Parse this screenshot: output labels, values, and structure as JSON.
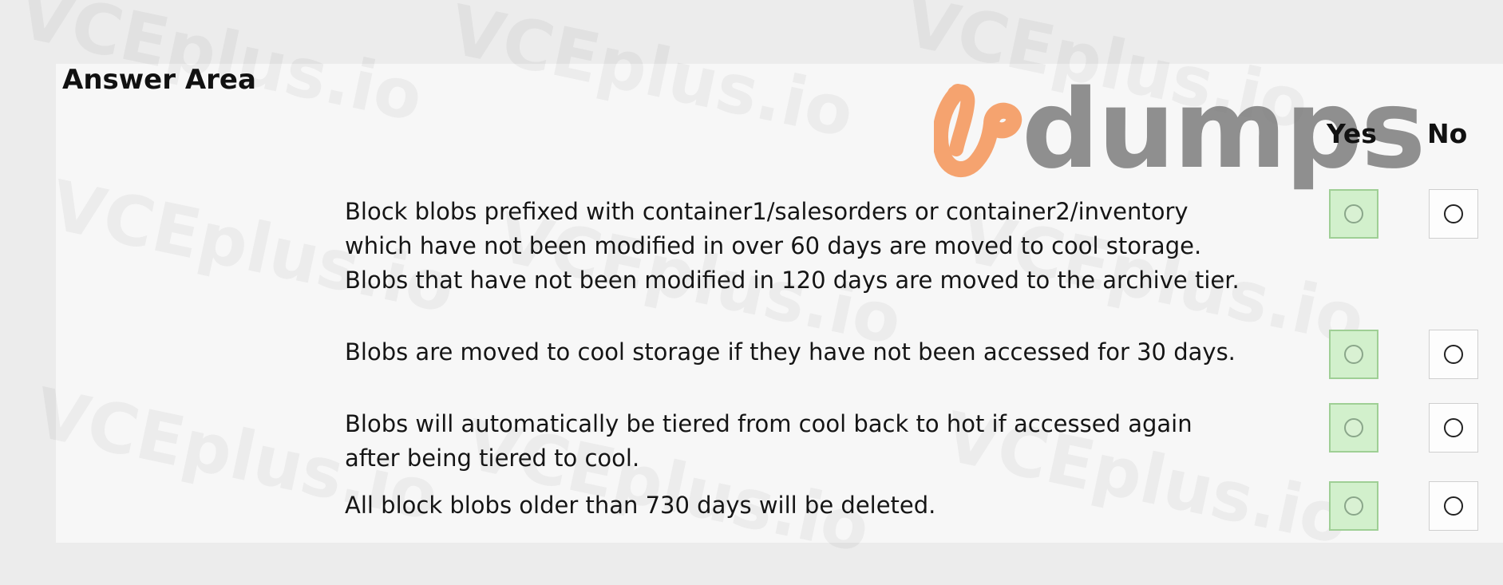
{
  "page": {
    "title": "Answer Area",
    "columns": {
      "yes": "Yes",
      "no": "No"
    },
    "watermark": "VCEplus.io",
    "logo": {
      "text": "dumps",
      "mark_color": "#f5a36f",
      "text_color": "#7d7d7d"
    },
    "colors": {
      "background": "#ececec",
      "panel": "#f7f7f7",
      "yes_fill": "#d2f0cc",
      "yes_border": "#9fcf95"
    }
  },
  "statements": [
    {
      "lines": [
        "Block blobs prefixed with container1/salesorders or container2/inventory",
        "which have not been modified in over 60 days are moved to cool storage.",
        "Blobs that have not been modified in 120 days are moved to the archive tier."
      ],
      "selected": "yes"
    },
    {
      "lines": [
        "Blobs are moved to cool storage if they have not been accessed for 30 days."
      ],
      "selected": "yes"
    },
    {
      "lines": [
        "Blobs will automatically be tiered from cool back to hot if accessed again",
        "after being tiered to cool."
      ],
      "selected": "yes"
    },
    {
      "lines": [
        "All block blobs older than 730 days will be deleted."
      ],
      "selected": "yes"
    }
  ]
}
